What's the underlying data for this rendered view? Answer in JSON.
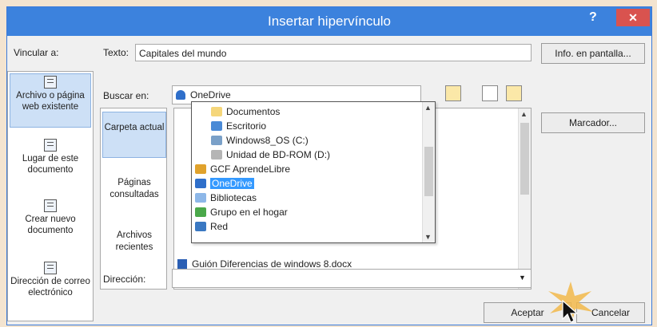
{
  "window": {
    "title": "Insertar hipervínculo",
    "help": "?",
    "close": "✕"
  },
  "link_to": {
    "label": "Vincular a:",
    "items": [
      {
        "label": "Archivo o página web existente",
        "icon": "web-page-icon",
        "active": true
      },
      {
        "label": "Lugar de este documento",
        "icon": "document-place-icon",
        "active": false
      },
      {
        "label": "Crear nuevo documento",
        "icon": "new-document-icon",
        "active": false
      },
      {
        "label": "Dirección de correo electrónico",
        "icon": "email-icon",
        "active": false
      }
    ]
  },
  "text_field": {
    "label": "Texto:",
    "value": "Capitales del mundo"
  },
  "screen_tip_button": "Info. en pantalla...",
  "look_in": {
    "label": "Buscar en:",
    "value": "OneDrive"
  },
  "middle_tabs": [
    {
      "label": "Carpeta actual",
      "active": true
    },
    {
      "label": "Páginas consultadas",
      "active": false
    },
    {
      "label": "Archivos recientes",
      "active": false
    }
  ],
  "bookmark_button": "Marcador...",
  "dropdown": {
    "items": [
      {
        "label": "Documentos",
        "icon": "folder-icon",
        "indent": 2,
        "selected": false
      },
      {
        "label": "Escritorio",
        "icon": "desktop-icon",
        "indent": 2,
        "selected": false
      },
      {
        "label": "Windows8_OS (C:)",
        "icon": "drive-icon",
        "indent": 2,
        "selected": false
      },
      {
        "label": "Unidad de BD-ROM (D:)",
        "icon": "dvd-drive-icon",
        "indent": 2,
        "selected": false
      },
      {
        "label": "GCF AprendeLibre",
        "icon": "user-folder-icon",
        "indent": 0,
        "selected": false
      },
      {
        "label": "OneDrive",
        "icon": "onedrive-icon",
        "indent": 0,
        "selected": true
      },
      {
        "label": "Bibliotecas",
        "icon": "libraries-icon",
        "indent": 0,
        "selected": false
      },
      {
        "label": "Grupo en el hogar",
        "icon": "homegroup-icon",
        "indent": 0,
        "selected": false
      },
      {
        "label": "Red",
        "icon": "network-icon",
        "indent": 0,
        "selected": false
      }
    ]
  },
  "file_list": {
    "items": [
      {
        "label": "Guión Diferencias de windows 8.docx",
        "icon": "word-doc-icon"
      }
    ]
  },
  "address": {
    "label": "Dirección:",
    "value": ""
  },
  "buttons": {
    "ok": "Aceptar",
    "cancel": "Cancelar"
  },
  "colors": {
    "titlebar": "#3c82dd",
    "close": "#d9534f",
    "selection": "#3399ff"
  }
}
